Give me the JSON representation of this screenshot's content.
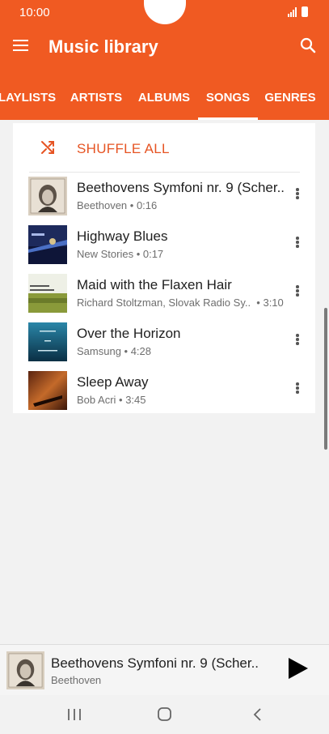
{
  "status_bar": {
    "time": "10:00"
  },
  "header": {
    "title": "Music library",
    "menu_icon": "hamburger-menu-icon",
    "search_icon": "search-icon"
  },
  "tabs": [
    {
      "label": "LAYLISTS",
      "active": false
    },
    {
      "label": "ARTISTS",
      "active": false
    },
    {
      "label": "ALBUMS",
      "active": false
    },
    {
      "label": "SONGS",
      "active": true
    },
    {
      "label": "GENRES",
      "active": false
    }
  ],
  "shuffle": {
    "label": "SHUFFLE ALL",
    "icon": "shuffle-icon"
  },
  "songs": [
    {
      "title": "Beethovens Symfoni nr. 9 (Scher..",
      "artist": "Beethoven",
      "duration": "0:16",
      "art": "beethoven-portrait"
    },
    {
      "title": "Highway Blues",
      "artist": "New Stories",
      "duration": "0:17",
      "art": "blue-night-road"
    },
    {
      "title": "Maid with the Flaxen Hair",
      "artist": "Richard Stoltzman, Slovak Radio Sy..",
      "duration": "3:10",
      "art": "richard-stoltzman-cover"
    },
    {
      "title": "Over the Horizon",
      "artist": "Samsung",
      "duration": "4:28",
      "art": "over-the-horizon-cover"
    },
    {
      "title": "Sleep Away",
      "artist": "Bob Acri",
      "duration": "3:45",
      "art": "piano-sunset-cover"
    }
  ],
  "now_playing": {
    "title": "Beethovens Symfoni nr. 9 (Scher..",
    "artist": "Beethoven",
    "play_icon": "play-icon"
  },
  "colors": {
    "accent": "#f05a22",
    "shuffle_text": "#e65423",
    "background": "#f2f2f2"
  }
}
